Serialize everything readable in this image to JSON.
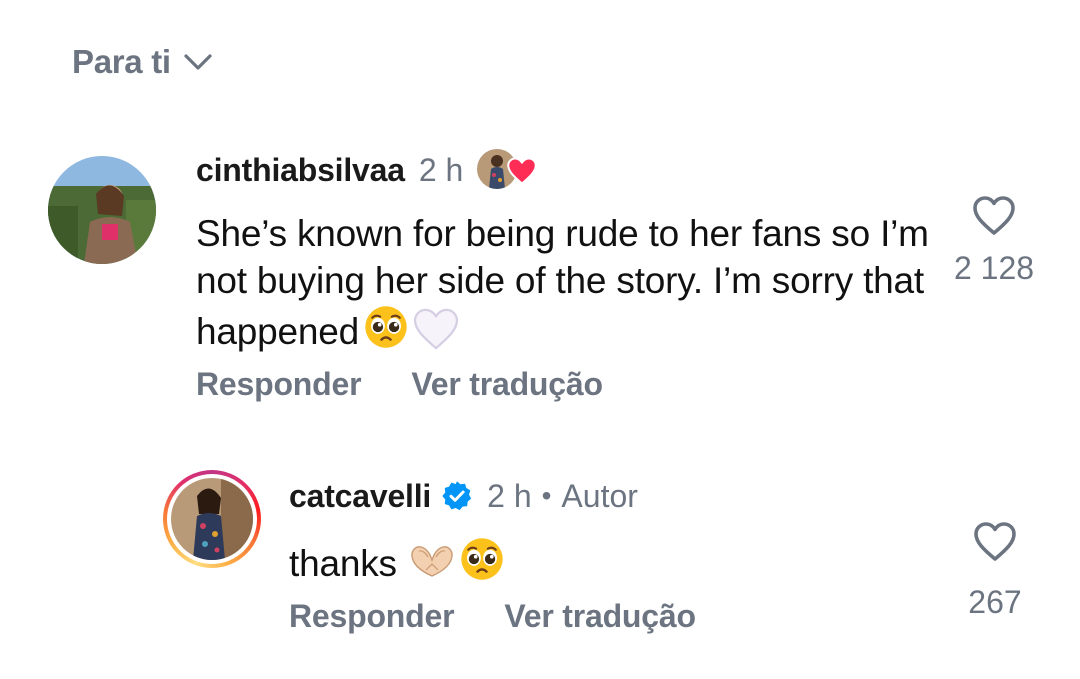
{
  "sort": {
    "label": "Para ti",
    "icon": "chevron-down-icon"
  },
  "comments": [
    {
      "username": "cinthiabsilvaa",
      "time": "2 h",
      "liked_by_author": true,
      "text": "She’s known for being rude to her fans so I’m not buying her side of the story. I’m sorry that happened",
      "emojis": [
        "pleading-face-emoji",
        "white-heart-emoji"
      ],
      "reply_label": "Responder",
      "translate_label": "Ver tradução",
      "likes": "2 128"
    },
    {
      "username": "catcavelli",
      "verified": true,
      "time": "2 h",
      "separator": "•",
      "author_label": "Autor",
      "text": "thanks",
      "emojis": [
        "heart-hands-emoji",
        "pleading-face-emoji"
      ],
      "reply_label": "Responder",
      "translate_label": "Ver tradução",
      "likes": "267"
    }
  ],
  "colors": {
    "muted": "#6b7480",
    "verified_blue": "#0095f6",
    "heart_red": "#ff2d55"
  }
}
